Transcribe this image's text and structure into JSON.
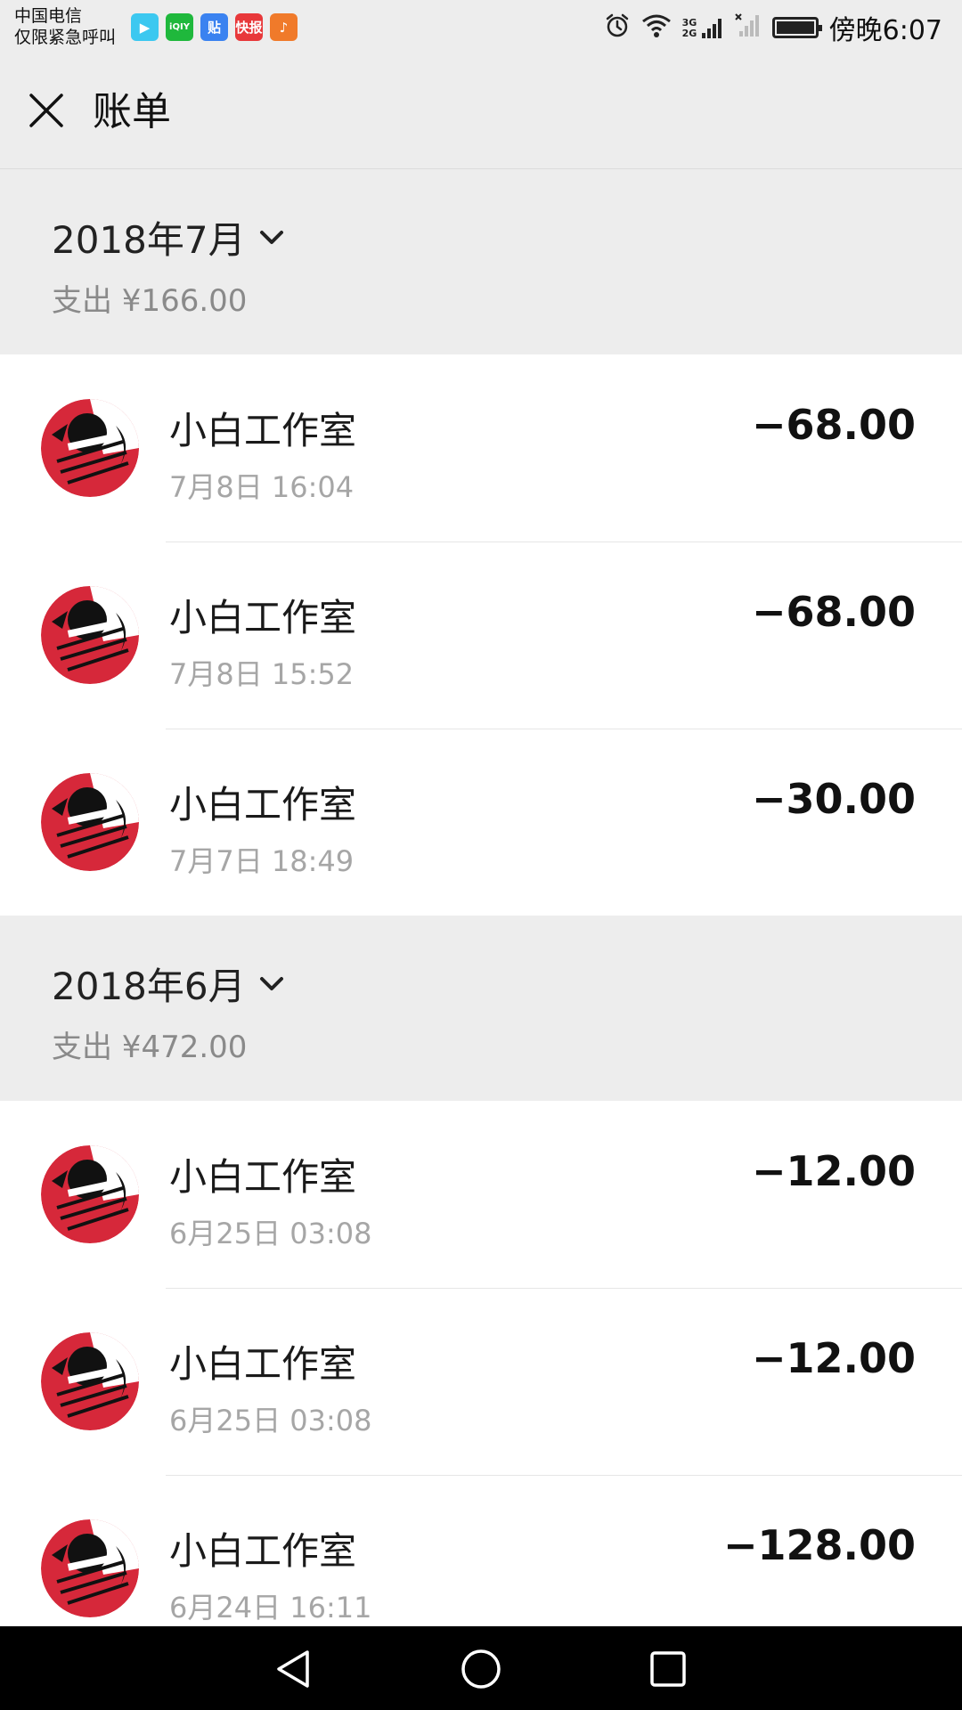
{
  "status_bar": {
    "carrier_line1": "中国电信",
    "carrier_line2": "仅限紧急呼叫",
    "app_icons": [
      {
        "name": "video-play-icon",
        "label": "▶",
        "color": "#3cc8f0"
      },
      {
        "name": "iqiyi-icon",
        "label": "iQIY",
        "color": "#1fb83c"
      },
      {
        "name": "tieba-icon",
        "label": "贴",
        "color": "#3a82f0"
      },
      {
        "name": "news-app-icon",
        "label": "快报",
        "color": "#e8383a"
      },
      {
        "name": "video-app-icon",
        "label": "♪",
        "color": "#f07a2a"
      }
    ],
    "network_label": "3G 2G",
    "time": "傍晚6:07"
  },
  "nav": {
    "title": "账单"
  },
  "months": [
    {
      "title": "2018年7月",
      "summary": "支出 ¥166.00",
      "transactions": [
        {
          "name": "小白工作室",
          "time": "7月8日 16:04",
          "amount": "−68.00"
        },
        {
          "name": "小白工作室",
          "time": "7月8日 15:52",
          "amount": "−68.00"
        },
        {
          "name": "小白工作室",
          "time": "7月7日 18:49",
          "amount": "−30.00"
        }
      ]
    },
    {
      "title": "2018年6月",
      "summary": "支出 ¥472.00",
      "transactions": [
        {
          "name": "小白工作室",
          "time": "6月25日 03:08",
          "amount": "−12.00"
        },
        {
          "name": "小白工作室",
          "time": "6月25日 03:08",
          "amount": "−12.00"
        },
        {
          "name": "小白工作室",
          "time": "6月24日 16:11",
          "amount": "−128.00"
        }
      ]
    }
  ],
  "colors": {
    "background": "#ededed",
    "card": "#ffffff",
    "secondary_text": "#8a8a8a",
    "avatar_red": "#d6283a"
  }
}
